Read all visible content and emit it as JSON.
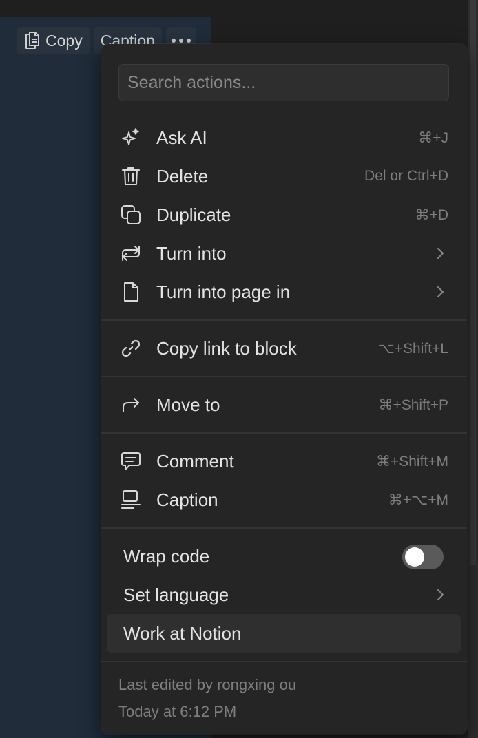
{
  "toolbar": {
    "copy_label": "Copy",
    "caption_label": "Caption",
    "more_icon": "more-horizontal-icon"
  },
  "search": {
    "placeholder": "Search actions...",
    "value": ""
  },
  "menu": {
    "groups": [
      [
        {
          "label": "Ask AI",
          "shortcut": "⌘+J",
          "icon": "sparkle-icon"
        },
        {
          "label": "Delete",
          "shortcut": "Del or Ctrl+D",
          "icon": "trash-icon"
        },
        {
          "label": "Duplicate",
          "shortcut": "⌘+D",
          "icon": "duplicate-icon"
        },
        {
          "label": "Turn into",
          "submenu": true,
          "icon": "turn-into-icon"
        },
        {
          "label": "Turn into page in",
          "submenu": true,
          "icon": "page-icon"
        }
      ],
      [
        {
          "label": "Copy link to block",
          "shortcut": "⌥+Shift+L",
          "icon": "link-icon"
        }
      ],
      [
        {
          "label": "Move to",
          "shortcut": "⌘+Shift+P",
          "icon": "move-arrow-icon"
        }
      ],
      [
        {
          "label": "Comment",
          "shortcut": "⌘+Shift+M",
          "icon": "comment-icon"
        },
        {
          "label": "Caption",
          "shortcut": "⌘+⌥+M",
          "icon": "caption-icon"
        }
      ],
      [
        {
          "label": "Wrap code",
          "toggle": false
        },
        {
          "label": "Set language",
          "submenu": true
        },
        {
          "label": "Work at Notion",
          "hovered": true
        }
      ]
    ]
  },
  "footer": {
    "edited_by": "Last edited by rongxing ou",
    "edited_at": "Today at 6:12 PM"
  },
  "colors": {
    "menu_bg": "#252525",
    "code_block_bg": "#202c3a",
    "text": "#e3e3e3",
    "muted": "#7e7e7e",
    "hover": "#2f2f2f"
  }
}
